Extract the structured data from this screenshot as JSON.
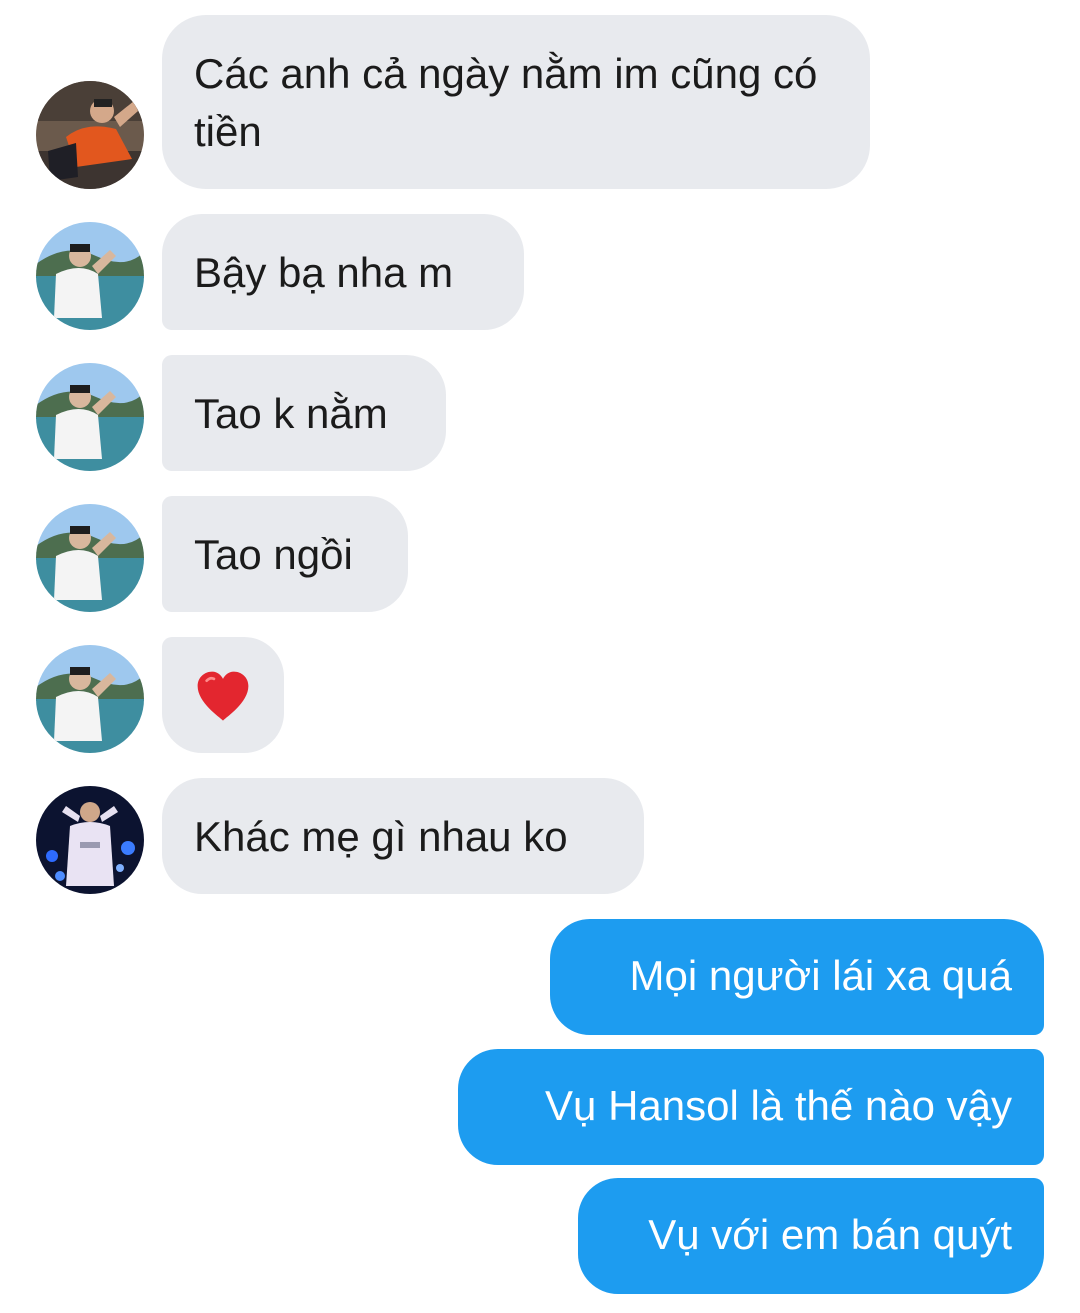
{
  "messages_in": [
    {
      "avatar": "avatar-orange-shirt",
      "text": "Các anh cả ngày nằm im cũng có tiền"
    },
    {
      "avatar": "avatar-sea-view",
      "text": "Bậy bạ nha m"
    },
    {
      "avatar": "avatar-sea-view",
      "text": "Tao k nằm"
    },
    {
      "avatar": "avatar-sea-view",
      "text": "Tao ngồi"
    },
    {
      "avatar": "avatar-sea-view",
      "text": "❤️",
      "icon": "red-heart-emoji"
    },
    {
      "avatar": "avatar-night-lights",
      "text": "Khác mẹ gì nhau ko"
    }
  ],
  "messages_out": [
    {
      "text": "Mọi người lái xa quá"
    },
    {
      "text": "Vụ Hansol là thế nào vậy"
    },
    {
      "text": "Vụ với em bán quýt"
    }
  ],
  "colors": {
    "incoming_bubble": "#e8eaee",
    "outgoing_bubble": "#1d9cf0",
    "outgoing_text": "#ffffff"
  }
}
